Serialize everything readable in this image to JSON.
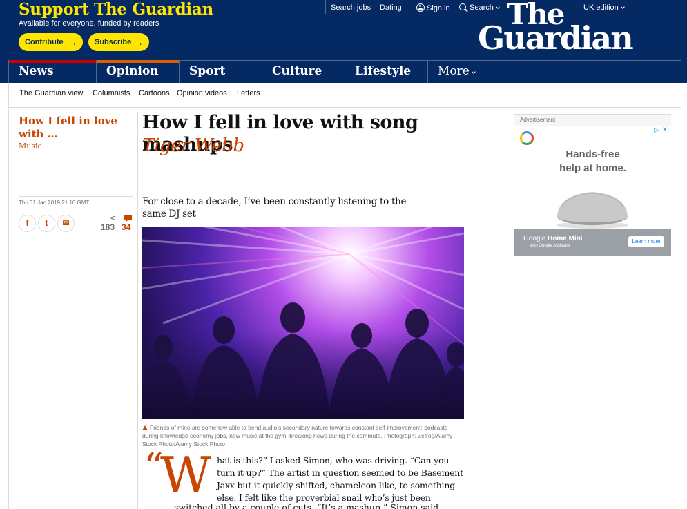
{
  "support": {
    "title": "Support The Guardian",
    "subtitle": "Available for everyone, funded by readers",
    "contribute_label": "Contribute",
    "subscribe_label": "Subscribe"
  },
  "topnav": {
    "search_jobs": "Search jobs",
    "dating": "Dating",
    "sign_in": "Sign in",
    "search": "Search",
    "edition": "UK edition"
  },
  "logo": {
    "line1": "The",
    "line2": "Guardian"
  },
  "pillars": [
    {
      "label": "News",
      "color": "#c70000"
    },
    {
      "label": "Opinion",
      "color": "#e05e00"
    },
    {
      "label": "Sport",
      "color": "#0084c6"
    },
    {
      "label": "Culture",
      "color": "#a1845c"
    },
    {
      "label": "Lifestyle",
      "color": "#bb3b80"
    },
    {
      "label": "More",
      "color": ""
    }
  ],
  "subnav": [
    "The Guardian view",
    "Columnists",
    "Cartoons",
    "Opinion videos",
    "Letters"
  ],
  "series": {
    "title": "How I fell in love with …",
    "tag": "Music"
  },
  "meta": {
    "date": "Thu 31 Jan 2019 21.10 GMT",
    "share_count": "183",
    "comment_count": "34",
    "share_facebook": "f",
    "share_twitter": "t",
    "share_email": "✉"
  },
  "article": {
    "headline": "How I fell in love with song mashups",
    "byline": "Tiger Webb",
    "standfirst": "For close to a decade, I’ve been constantly listening to the same DJ set",
    "caption": "Friends of mine are somehow able to bend audio’s secondary nature towards constant self-improvement: podcasts during knowledge economy jobs, new music at the gym, breaking news during the commute. Photograph: Zefrog/Alamy Stock Photo/Alamy Stock Photo",
    "dropcap_quote": "“",
    "dropcap_letter": "W",
    "body_first": "hat is this?” I asked Simon, who was driving. “Can you turn it up?” The artist in question seemed to be Basement Jaxx but it quickly shifted, chameleon-like, to something else. I felt like the proverbial snail who’s just been",
    "body_cont": "switched all by a couple of cuts. “It’s a mashup,” Simon said."
  },
  "ad": {
    "label": "Advertisement",
    "headline_line1": "Hands-free",
    "headline_line2": "help at home.",
    "product_brand": "Google",
    "product_name": "Home Mini",
    "with_line": "with Google Assistant",
    "cta": "Learn more",
    "adchoices": "▷",
    "close": "✕"
  },
  "colors": {
    "brand_blue": "#052962",
    "support_yellow": "#ffe500",
    "opinion_orange": "#c74600"
  }
}
